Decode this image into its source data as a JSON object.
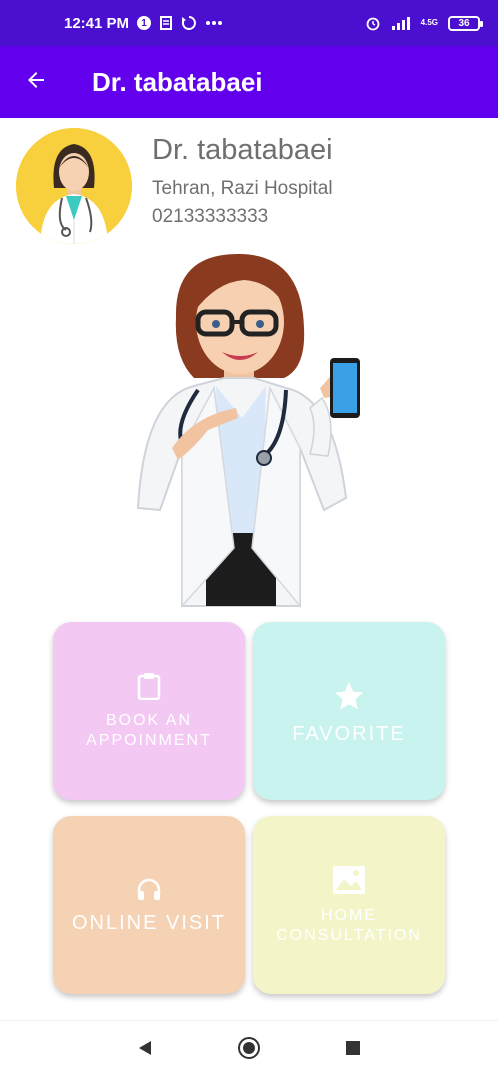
{
  "status_bar": {
    "time": "12:41 PM",
    "notification_count": "1",
    "network_label": "4.5G",
    "battery": "36"
  },
  "app_bar": {
    "title": "Dr. tabatabaei"
  },
  "profile": {
    "name": "Dr. tabatabaei",
    "location": "Tehran, Razi Hospital",
    "phone": "02133333333"
  },
  "tiles": [
    {
      "line1": "BOOK AN",
      "line2": "APPOINMENT",
      "icon": "clipboard-icon",
      "color": "#f3c9f4"
    },
    {
      "line1": "FAVORITE",
      "icon": "star-icon",
      "color": "#c8f3ee"
    },
    {
      "line1": "ONLINE VISIT",
      "icon": "headset-icon",
      "color": "#f6d2b4"
    },
    {
      "line1": "HOME",
      "line2": "CONSULTATION",
      "icon": "image-icon",
      "color": "#f3f5c9"
    }
  ],
  "colors": {
    "status_bar": "#4b0fcf",
    "app_bar": "#6200ee"
  }
}
